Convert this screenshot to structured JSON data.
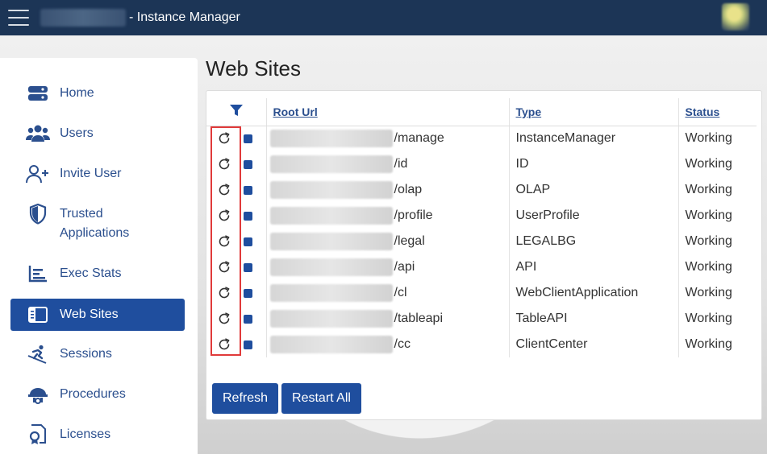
{
  "topbar": {
    "title": "- Instance Manager"
  },
  "sidebar": {
    "items": [
      {
        "label": "Home",
        "icon": "home-icon"
      },
      {
        "label": "Users",
        "icon": "users-icon"
      },
      {
        "label": "Invite User",
        "icon": "invite-user-icon"
      },
      {
        "label": "Trusted\nApplications",
        "icon": "shield-icon"
      },
      {
        "label": "Exec Stats",
        "icon": "chart-icon"
      },
      {
        "label": "Web Sites",
        "icon": "web-sites-icon",
        "active": true
      },
      {
        "label": "Sessions",
        "icon": "skier-icon"
      },
      {
        "label": "Procedures",
        "icon": "procedures-icon"
      },
      {
        "label": "Licenses",
        "icon": "license-icon"
      }
    ]
  },
  "page": {
    "title": "Web Sites"
  },
  "table": {
    "headers": {
      "root_url": "Root Url",
      "type": "Type",
      "status": "Status"
    },
    "rows": [
      {
        "path": "/manage",
        "type": "InstanceManager",
        "status": "Working"
      },
      {
        "path": "/id",
        "type": "ID",
        "status": "Working"
      },
      {
        "path": "/olap",
        "type": "OLAP",
        "status": "Working"
      },
      {
        "path": "/profile",
        "type": "UserProfile",
        "status": "Working"
      },
      {
        "path": "/legal",
        "type": "LEGALBG",
        "status": "Working"
      },
      {
        "path": "/api",
        "type": "API",
        "status": "Working"
      },
      {
        "path": "/cl",
        "type": "WebClientApplication",
        "status": "Working"
      },
      {
        "path": "/tableapi",
        "type": "TableAPI",
        "status": "Working"
      },
      {
        "path": "/cc",
        "type": "ClientCenter",
        "status": "Working"
      }
    ]
  },
  "buttons": {
    "refresh": "Refresh",
    "restart_all": "Restart All"
  },
  "colors": {
    "brand": "#1f4e9e",
    "topbar": "#1c3556",
    "highlight": "#e03a3a"
  }
}
